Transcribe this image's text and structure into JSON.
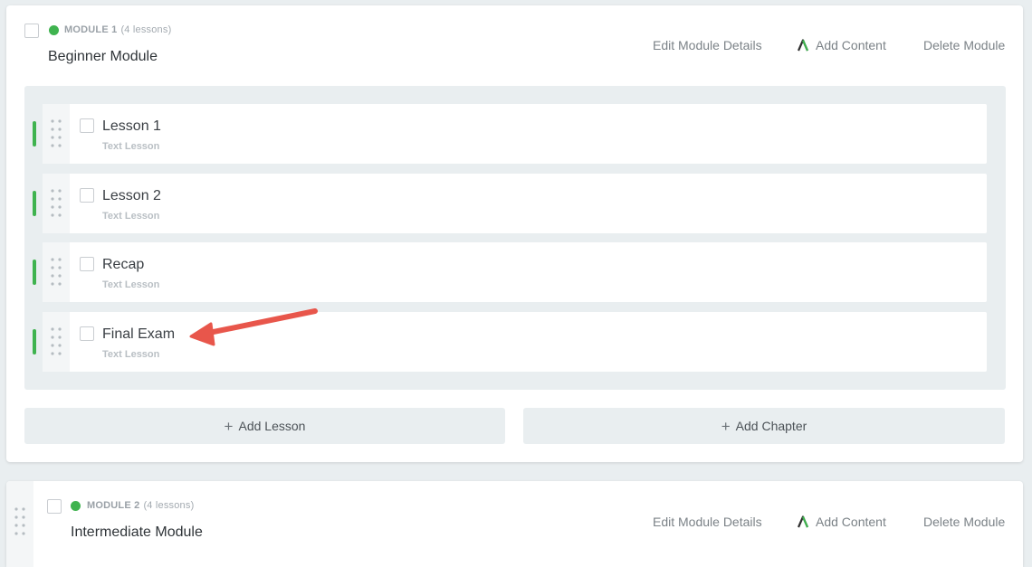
{
  "modules": [
    {
      "label": "MODULE 1",
      "count": "(4 lessons)",
      "title": "Beginner Module",
      "actions": {
        "edit": "Edit Module Details",
        "add_content": "Add Content",
        "delete": "Delete Module"
      },
      "lessons": [
        {
          "title": "Lesson 1",
          "type": "Text Lesson"
        },
        {
          "title": "Lesson 2",
          "type": "Text Lesson"
        },
        {
          "title": "Recap",
          "type": "Text Lesson"
        },
        {
          "title": "Final Exam",
          "type": "Text Lesson"
        }
      ],
      "buttons": {
        "add_lesson": "Add Lesson",
        "add_chapter": "Add Chapter"
      }
    },
    {
      "label": "MODULE 2",
      "count": "(4 lessons)",
      "title": "Intermediate Module",
      "actions": {
        "edit": "Edit Module Details",
        "add_content": "Add Content",
        "delete": "Delete Module"
      }
    }
  ],
  "icons": {
    "status": "green-dot-icon",
    "drag": "drag-handle-icon",
    "add": "plus-icon",
    "brand": "brand-logo-icon",
    "annotation": "red-arrow-icon"
  },
  "colors": {
    "status_green": "#3fb34f",
    "annotation_red": "#e8564b",
    "panel_bg": "#e9eef0"
  }
}
